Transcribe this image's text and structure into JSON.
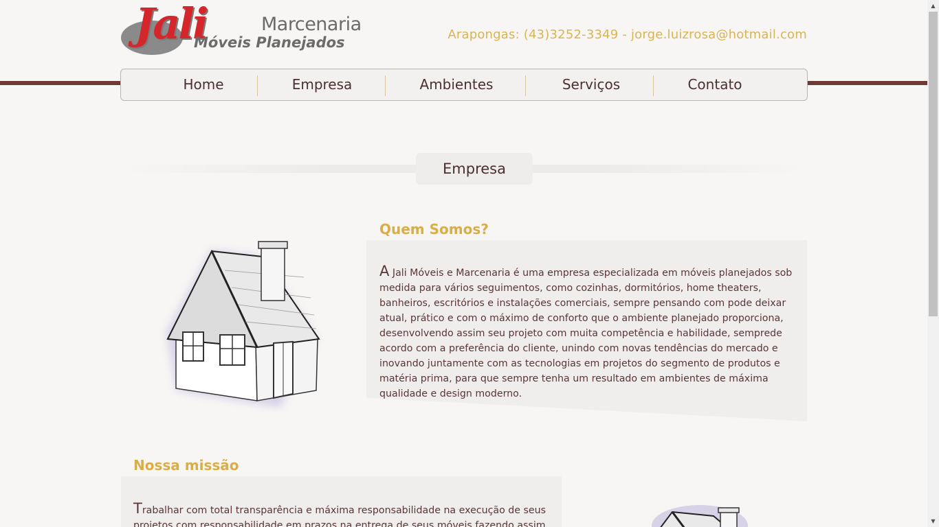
{
  "header": {
    "logo": {
      "brand": "Jali",
      "line1": "Marcenaria",
      "line2": "Móveis Planejados"
    },
    "contact": "Arapongas: (43)3252-3349 - jorge.luizrosa@hotmail.com"
  },
  "nav": {
    "items": [
      {
        "label": "Home"
      },
      {
        "label": "Empresa"
      },
      {
        "label": "Ambientes"
      },
      {
        "label": "Serviços"
      },
      {
        "label": "Contato"
      }
    ]
  },
  "section": {
    "title": "Empresa"
  },
  "quem_somos": {
    "heading": "Quem Somos?",
    "dropcap": "A",
    "text": " Jali Móveis e Marcenaria é uma empresa especializada em móveis planejados sob medida para vários seguimentos, como cozinhas, dormitórios, home theaters, banheiros, escritórios e instalações comerciais, sempre pensando com pode deixar atual, prático e com o máximo de conforto que o ambiente planejado proporciona, desenvolvendo assim seu projeto com muita competência e habilidade, semprede acordo com a preferência do cliente, unindo com novas tendências do mercado e inovando juntamente com as tecnologias em projetos do segmento de produtos e matéria prima, para que sempre tenha um resultado em ambientes de máxima qualidade e design moderno."
  },
  "missao": {
    "heading": "Nossa missão",
    "dropcap": "T",
    "text": "rabalhar com total transparência e máxima responsabilidade na execução de seus projetos com responsabilidade em prazos na entrega de seus móveis fazendo assim"
  },
  "colors": {
    "accent_gold": "#d8ae4a",
    "nav_bar": "#6e3a36",
    "text_brown": "#4a2f2f",
    "brand_red": "#d4262b"
  },
  "icons": {
    "illustration": "house-sketch-icon",
    "scroll_up": "arrow-up-icon",
    "scroll_down": "arrow-down-icon"
  }
}
